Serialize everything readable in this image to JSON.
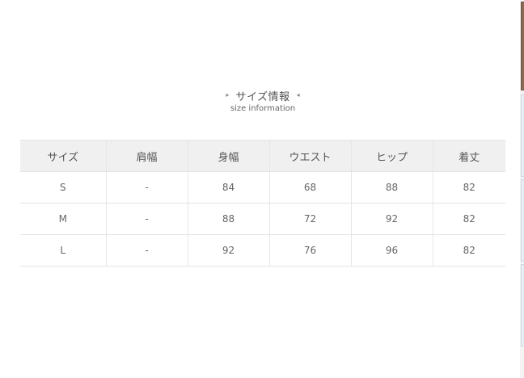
{
  "heading": {
    "title": "サイズ情報",
    "subtitle": "size information",
    "left_marker": "▸",
    "right_marker": "◂"
  },
  "table": {
    "headers": [
      "サイズ",
      "肩幅",
      "身幅",
      "ウエスト",
      "ヒップ",
      "着丈"
    ],
    "rows": [
      [
        "S",
        "-",
        "84",
        "68",
        "88",
        "82"
      ],
      [
        "M",
        "-",
        "88",
        "72",
        "92",
        "82"
      ],
      [
        "L",
        "-",
        "92",
        "76",
        "96",
        "82"
      ]
    ]
  },
  "colors": {
    "header_background": "#f1f0f1",
    "border": "#e3e3e3",
    "text": "#666666"
  }
}
